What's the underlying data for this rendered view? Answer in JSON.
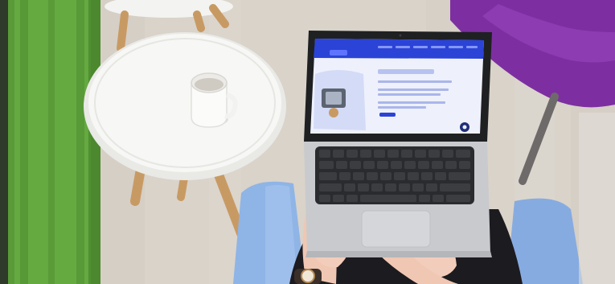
{
  "scene": {
    "screen": {
      "nav_items": [
        "",
        "",
        "",
        "",
        "",
        ""
      ],
      "headline": "",
      "body_lines": []
    }
  },
  "colors": {
    "floor": "#d8d2c8",
    "grass": "#5f9f3a",
    "table": "#f3f3f1",
    "table_leg": "#c89a63",
    "chair_purple": "#7d2fa1",
    "chair_blue": "#8fb4e6",
    "laptop_silver": "#c8c9cc",
    "screen_blue": "#2b43d6",
    "skin": "#f0c7b3",
    "clothes": "#1c1b1f"
  }
}
